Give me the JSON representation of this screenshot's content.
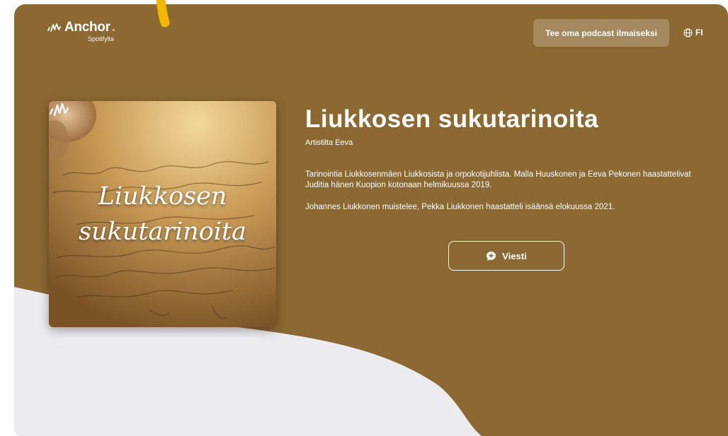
{
  "header": {
    "logo_text": "Anchor",
    "logo_dot": ".",
    "logo_sub": "Spotifylta",
    "cta_label": "Tee oma podcast ilmaiseksi",
    "language": "FI"
  },
  "podcast": {
    "title": "Liukkosen sukutarinoita",
    "author": "Artistilta Eeva",
    "description": [
      "Tarinointia Liukkosenmäen Liukkosista ja orpokotijuhlista. Malla Huuskonen ja Eeva Pekonen haastattelivat Juditia hänen Kuopion kotonaan helmikuussa 2019.",
      "Johannes Liukkonen muistelee, Pekka Liukkonen haastatteli isäänsä elokuussa 2021."
    ],
    "message_label": "Viesti"
  },
  "cover": {
    "title_line1": "Liukkosen",
    "title_line2": "sukutarinoita"
  },
  "colors": {
    "brand_brown": "#8c6832",
    "accent_yellow": "#f5b800",
    "light_wave": "#ececf0"
  },
  "icons": {
    "logo": "anchor-logo-icon",
    "globe": "globe-icon",
    "message": "message-plus-icon"
  }
}
